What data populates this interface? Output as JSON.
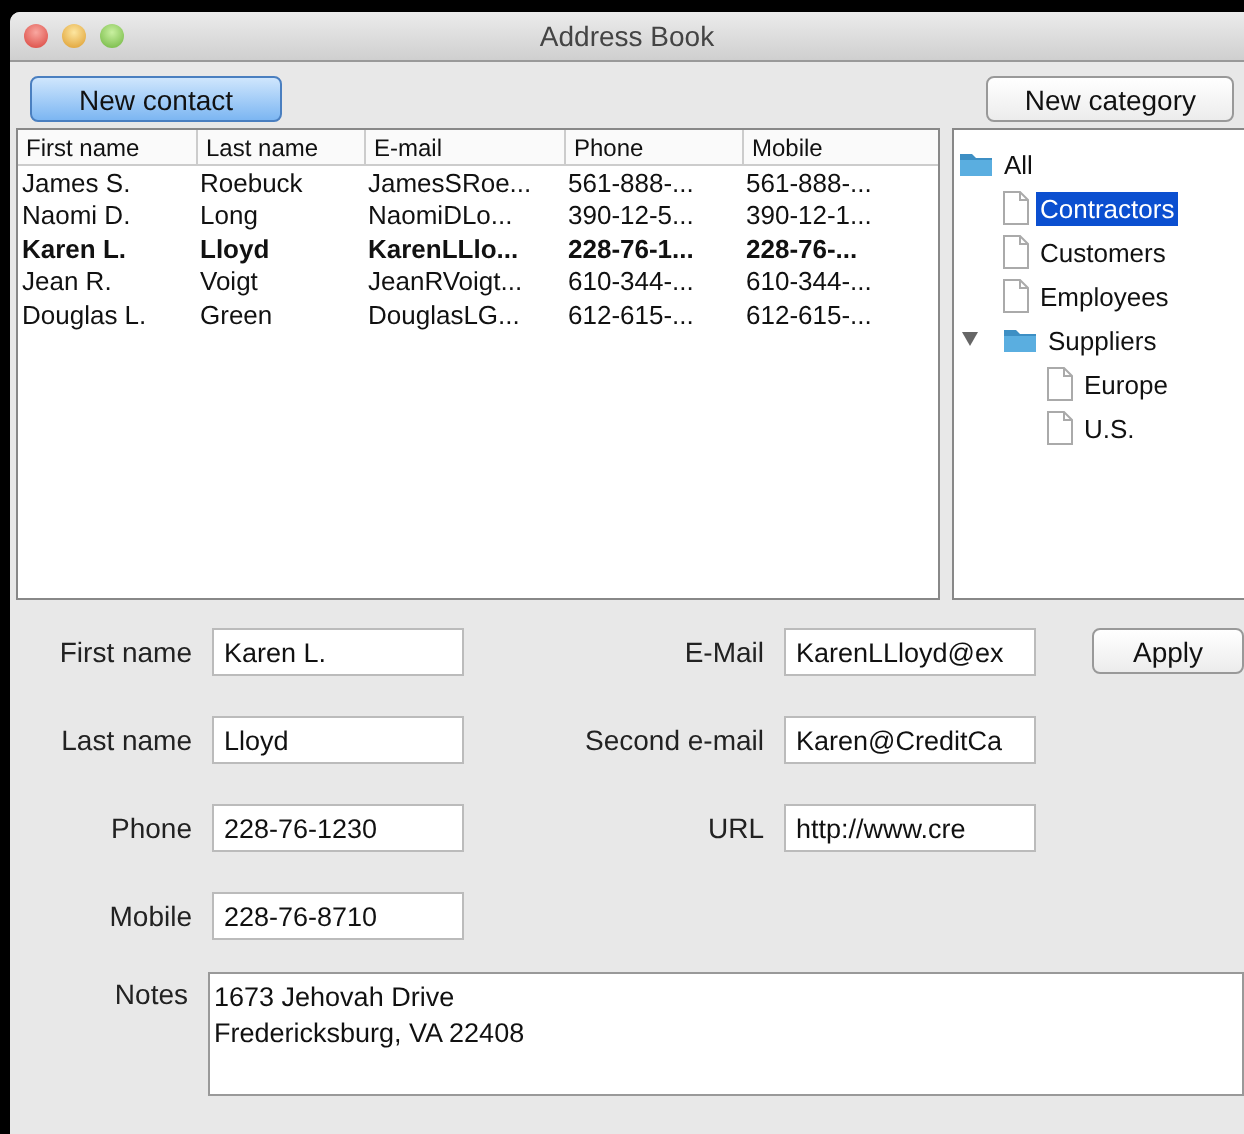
{
  "window": {
    "title": "Address Book"
  },
  "toolbar": {
    "new_contact": "New contact",
    "new_category": "New category"
  },
  "table": {
    "columns": [
      "First name",
      "Last name",
      "E-mail",
      "Phone",
      "Mobile"
    ],
    "rows": [
      {
        "cells": [
          "James S.",
          "Roebuck",
          "JamesSRoe...",
          "561-888-...",
          "561-888-..."
        ],
        "selected": false
      },
      {
        "cells": [
          "Naomi D.",
          "Long",
          "NaomiDLo...",
          "390-12-5...",
          "390-12-1..."
        ],
        "selected": false
      },
      {
        "cells": [
          "Karen L.",
          "Lloyd",
          "KarenLLlo...",
          "228-76-1...",
          "228-76-..."
        ],
        "selected": true
      },
      {
        "cells": [
          "Jean R.",
          "Voigt",
          "JeanRVoigt...",
          "610-344-...",
          "610-344-..."
        ],
        "selected": false
      },
      {
        "cells": [
          "Douglas L.",
          "Green",
          "DouglasLG...",
          "612-615-...",
          "612-615-..."
        ],
        "selected": false
      }
    ]
  },
  "tree": [
    {
      "label": "All",
      "kind": "folder",
      "selected": false,
      "children": [
        {
          "label": "Contractors",
          "kind": "leaf",
          "selected": true
        },
        {
          "label": "Customers",
          "kind": "leaf",
          "selected": false
        },
        {
          "label": "Employees",
          "kind": "leaf",
          "selected": false
        },
        {
          "label": "Suppliers",
          "kind": "folder",
          "selected": false,
          "expanded": true,
          "children": [
            {
              "label": "Europe",
              "kind": "leaf",
              "selected": false
            },
            {
              "label": "U.S.",
              "kind": "leaf",
              "selected": false
            }
          ]
        }
      ]
    }
  ],
  "form": {
    "left": [
      {
        "label": "First name",
        "value": "Karen L."
      },
      {
        "label": "Last name",
        "value": "Lloyd"
      },
      {
        "label": "Phone",
        "value": "228-76-1230"
      },
      {
        "label": "Mobile",
        "value": "228-76-8710"
      }
    ],
    "right": [
      {
        "label": "E-Mail",
        "value": "KarenLLloyd@ex"
      },
      {
        "label": "Second e-mail",
        "value": "Karen@CreditCa"
      },
      {
        "label": "URL",
        "value": "http://www.cre"
      }
    ],
    "apply": "Apply",
    "notes": {
      "label": "Notes",
      "value": "1673 Jehovah Drive\nFredericksburg, VA 22408"
    }
  }
}
